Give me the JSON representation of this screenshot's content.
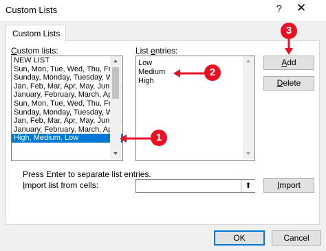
{
  "dialog": {
    "title": "Custom Lists",
    "help_glyph": "?",
    "close_glyph": "✕",
    "tab_label": "Custom Lists"
  },
  "custom_lists": {
    "label": "Custom lists:",
    "items": [
      "NEW LIST",
      "Sun, Mon, Tue, Wed, Thu, Fri,",
      "Sunday, Monday, Tuesday, We",
      "Jan, Feb, Mar, Apr, May, Jun, Ju",
      "January, February, March, Apri",
      "Sun, Mon, Tue, Wed, Thu, Fri,",
      "Sunday, Monday, Tuesday, We",
      "Jan, Feb, Mar, Apr, May, Jun, Ju",
      "January, February, March, Apri",
      "High, Medium, Low"
    ],
    "selected_index": 9
  },
  "list_entries": {
    "label": "List entries:",
    "lines": [
      "Low",
      "Medium",
      "High"
    ]
  },
  "buttons": {
    "add": "Add",
    "delete": "Delete",
    "import": "Import",
    "ok": "OK",
    "cancel": "Cancel"
  },
  "import_section": {
    "hint": "Press Enter to separate list entries.",
    "label": "Import list from cells:",
    "collapse_glyph": "⬆"
  },
  "callouts": [
    "1",
    "2",
    "3"
  ],
  "colors": {
    "accent": "#0078d7",
    "callout": "#e81123"
  }
}
